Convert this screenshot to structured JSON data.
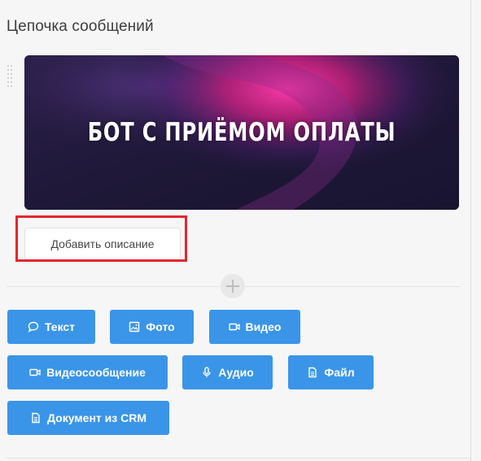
{
  "header": {
    "title": "Цепочка сообщений"
  },
  "banner": {
    "text": "БОТ С ПРИЁМОМ ОПЛАТЫ",
    "colors": {
      "background": "#211a38",
      "glow": "#ff2f9e"
    }
  },
  "description_button": {
    "label": "Добавить описание",
    "highlight_color": "#e3262f"
  },
  "divider": {
    "add_icon": "plus-icon"
  },
  "toolbar": {
    "accent": "#3a95e8",
    "buttons": [
      {
        "label": "Текст",
        "icon": "chat-bubble-icon"
      },
      {
        "label": "Фото",
        "icon": "image-icon"
      },
      {
        "label": "Видео",
        "icon": "video-camera-icon"
      },
      {
        "label": "Видеосообщение",
        "icon": "video-camera-icon"
      },
      {
        "label": "Аудио",
        "icon": "microphone-icon"
      },
      {
        "label": "Файл",
        "icon": "document-icon"
      },
      {
        "label": "Документ из CRM",
        "icon": "document-icon"
      }
    ]
  }
}
